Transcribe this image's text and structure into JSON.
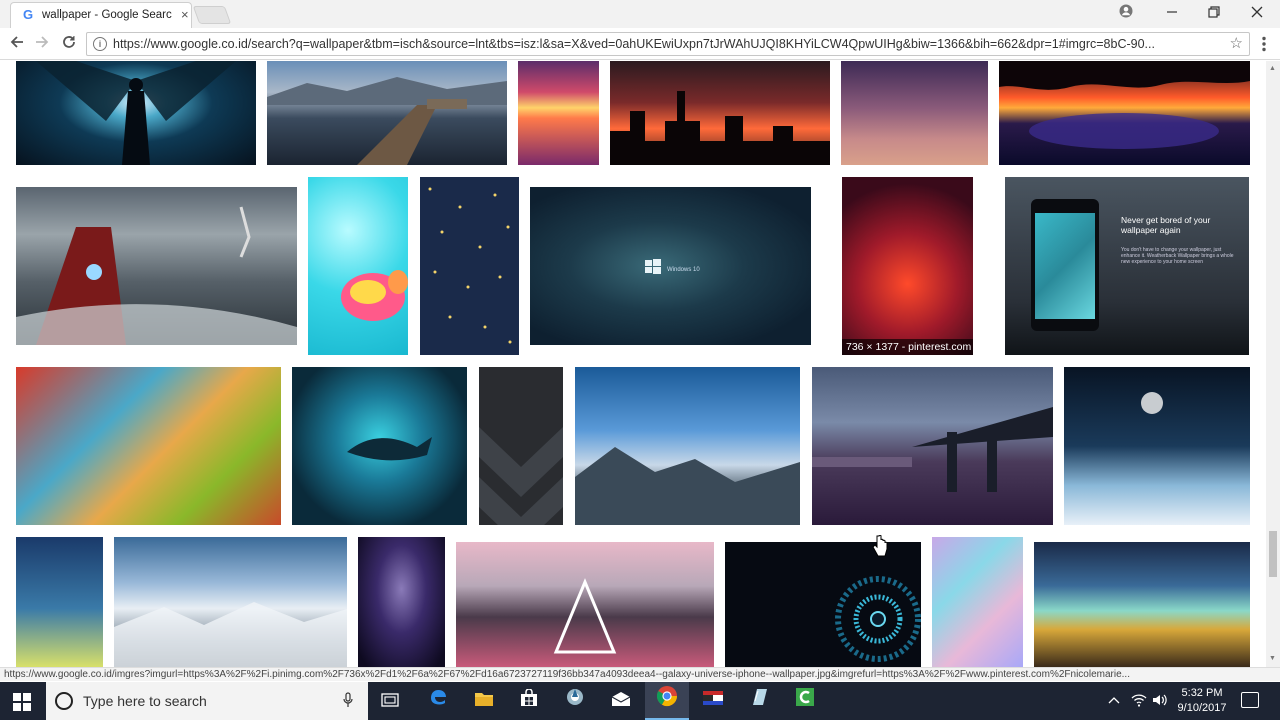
{
  "browser": {
    "tab_title": "wallpaper - Google Search",
    "tab_favicon": "G",
    "tab_close": "×",
    "url": "https://www.google.co.id/search?q=wallpaper&tbm=isch&source=lnt&tbs=isz:l&sa=X&ved=0ahUKEwiUxpn7tJrWAhUJQI8KHYiLCW4QpwUIHg&biw=1366&bih=662&dpr=1#imgrc=8bC-90...",
    "status_url": "https://www.google.co.id/imgres?imgurl=https%3A%2F%2Fi.pinimg.com%2F736x%2Fd1%2F6a%2F67%2Fd16a6723727119f36bb347a4093deea4--galaxy-universe-iphone--wallpaper.jpg&imgrefurl=https%3A%2F%2Fwww.pinterest.com%2Fnicolemarie..."
  },
  "results": {
    "hover_caption": "736 × 1377 - pinterest.com",
    "phone_ad_title": "Never get bored of your wallpaper again",
    "phone_ad_body": "You don't have to change your wallpaper, just enhance it. Weatherback Wallpaper brings a whole new experience to your home screen",
    "win_logo_text": "Windows 10"
  },
  "taskbar": {
    "search_placeholder": "Type here to search",
    "time": "5:32 PM",
    "date": "9/10/2017"
  },
  "colors": {
    "taskbar_bg": "#1d2433",
    "chrome_bg": "#f2f2f2"
  }
}
